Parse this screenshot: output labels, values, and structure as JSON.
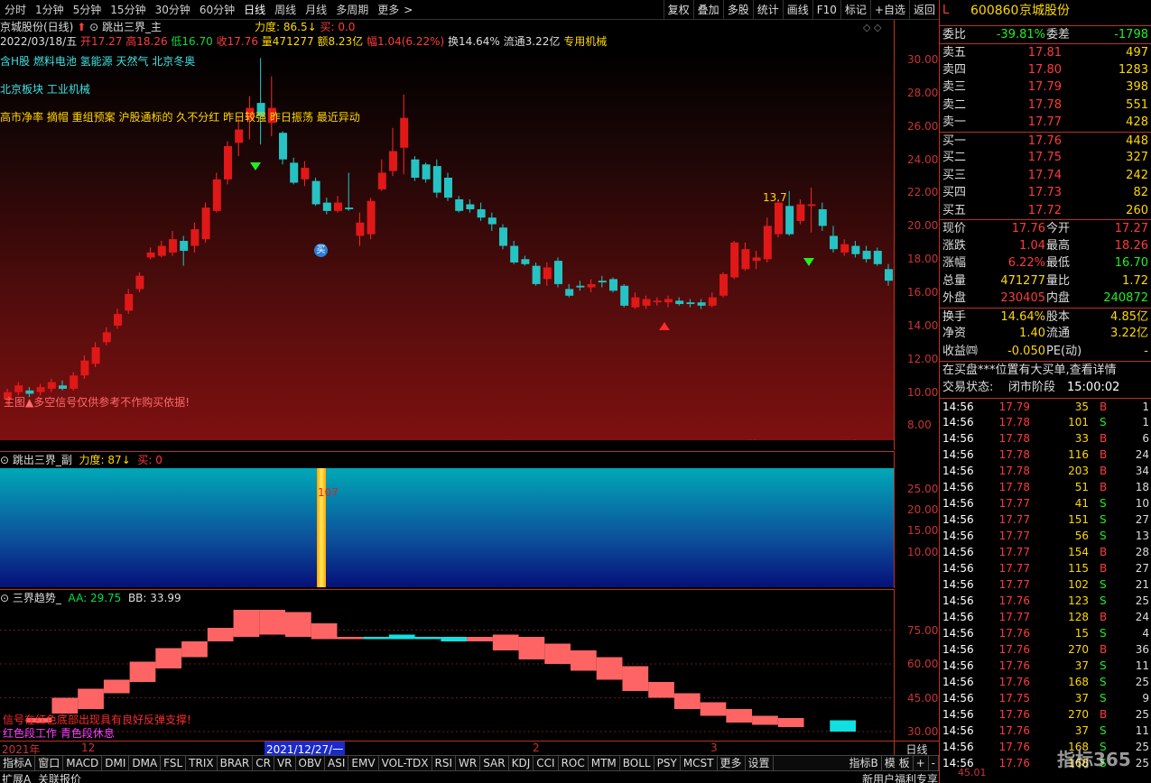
{
  "toolbar": {
    "periods": [
      "分时",
      "1分钟",
      "5分钟",
      "15分钟",
      "30分钟",
      "60分钟",
      "日线",
      "周线",
      "月线",
      "多周期",
      "更多"
    ],
    "active": "日线",
    "right_buttons": [
      "复权",
      "叠加",
      "多股",
      "统计",
      "画线",
      "F10",
      "标记",
      "+自选",
      "返回"
    ]
  },
  "main": {
    "stock": "京城股份(日线)",
    "formula": "跳出三界_主",
    "force_label": "力度: 86.5",
    "force_arrow": "↓",
    "buy_label": "买: 0.0",
    "date": "2022/03/18/五",
    "open": "开17.27",
    "high": "高18.26",
    "low": "低16.70",
    "close": "收17.76",
    "volume": "量471277",
    "amount": "额8.23亿",
    "change": "幅1.04(6.22%)",
    "turnover": "换14.64%",
    "float": "流通3.22亿",
    "industry": "专用机械",
    "concepts1": "含H股 燃料电池 氢能源 天然气 北京冬奥",
    "concepts2": "北京板块 工业机械",
    "concepts3": "高市净率 摘帽 重组预案 沪股通标的 久不分红 昨日较强 昨日振荡 最近异动",
    "notice": "主图▲多空信号仅供参考不作购买依据!",
    "peak_label": "13.7",
    "buy_marker": "买",
    "events": [
      "跌",
      "榜",
      "涨财"
    ]
  },
  "axis_main": [
    "30.00",
    "28.00",
    "26.00",
    "24.00",
    "22.00",
    "20.00",
    "18.00",
    "16.00",
    "14.00",
    "12.00",
    "10.00",
    "8.00"
  ],
  "sub1": {
    "title": "跳出三界_副",
    "force_label": "力度: 87",
    "force_arrow": "↓",
    "buy_label": "买: 0",
    "bar_label": "107",
    "axis": [
      "25.00",
      "20.00",
      "15.00",
      "10.00"
    ]
  },
  "sub2": {
    "title": "三界趋势_",
    "aa": "AA: 29.75",
    "bb": "BB: 33.99",
    "axis": [
      "75.00",
      "60.00",
      "45.00",
      "30.00"
    ],
    "note1": "信号在红色底部出现具有良好反弹支撑!",
    "note2": "红色段工作  青色段休息"
  },
  "dateaxis": {
    "labels": [
      "2021年",
      "12",
      "2021/12/27/一",
      "2",
      "3"
    ],
    "period": "日线"
  },
  "indicators": [
    "指标A",
    "窗口",
    "MACD",
    "DMI",
    "DMA",
    "FSL",
    "TRIX",
    "BRAR",
    "CR",
    "VR",
    "OBV",
    "ASI",
    "EMV",
    "VOL-TDX",
    "RSI",
    "WR",
    "SAR",
    "KDJ",
    "CCI",
    "ROC",
    "MTM",
    "BOLL",
    "PSY",
    "MCST",
    "更多",
    "设置"
  ],
  "indicator_right": [
    "指标B",
    "模 板",
    "+",
    "-"
  ],
  "bottom": {
    "left": [
      "扩展A",
      "关联报价"
    ],
    "right": "新用户福利专享",
    "price": "45.01"
  },
  "quote": {
    "flag": "L",
    "code": "600860",
    "name": "京城股份",
    "weibi_label": "委比",
    "weibi": "-39.81%",
    "weicha_label": "委差",
    "weicha": "-1798",
    "asks": [
      {
        "label": "卖五",
        "price": "17.81",
        "vol": "497"
      },
      {
        "label": "卖四",
        "price": "17.80",
        "vol": "1283"
      },
      {
        "label": "卖三",
        "price": "17.79",
        "vol": "398"
      },
      {
        "label": "卖二",
        "price": "17.78",
        "vol": "551"
      },
      {
        "label": "卖一",
        "price": "17.77",
        "vol": "428"
      }
    ],
    "bids": [
      {
        "label": "买一",
        "price": "17.76",
        "vol": "448"
      },
      {
        "label": "买二",
        "price": "17.75",
        "vol": "327"
      },
      {
        "label": "买三",
        "price": "17.74",
        "vol": "242"
      },
      {
        "label": "买四",
        "price": "17.73",
        "vol": "82"
      },
      {
        "label": "买五",
        "price": "17.72",
        "vol": "260"
      }
    ],
    "stats": [
      [
        "现价",
        "17.76",
        "今开",
        "17.27"
      ],
      [
        "涨跌",
        "1.04",
        "最高",
        "18.26"
      ],
      [
        "涨幅",
        "6.22%",
        "最低",
        "16.70"
      ],
      [
        "总量",
        "471277",
        "量比",
        "1.72"
      ],
      [
        "外盘",
        "230405",
        "内盘",
        "240872"
      ],
      [
        "换手",
        "14.64%",
        "股本",
        "4.85亿"
      ],
      [
        "净资",
        "1.40",
        "流通",
        "3.22亿"
      ],
      [
        "收益㈣",
        "-0.050",
        "PE(动)",
        "-"
      ]
    ],
    "message": "在买盘***位置有大买单,查看详情",
    "status_label": "交易状态:",
    "status": "闭市阶段",
    "status_time": "15:00:02"
  },
  "ticks": [
    [
      "14:56",
      "17.79",
      "35",
      "B",
      "1"
    ],
    [
      "14:56",
      "17.78",
      "101",
      "S",
      "1"
    ],
    [
      "14:56",
      "17.78",
      "33",
      "B",
      "6"
    ],
    [
      "14:56",
      "17.78",
      "116",
      "B",
      "24"
    ],
    [
      "14:56",
      "17.78",
      "203",
      "B",
      "34"
    ],
    [
      "14:56",
      "17.78",
      "51",
      "B",
      "18"
    ],
    [
      "14:56",
      "17.77",
      "41",
      "S",
      "10"
    ],
    [
      "14:56",
      "17.77",
      "151",
      "S",
      "27"
    ],
    [
      "14:56",
      "17.77",
      "56",
      "S",
      "13"
    ],
    [
      "14:56",
      "17.77",
      "154",
      "B",
      "28"
    ],
    [
      "14:56",
      "17.77",
      "115",
      "B",
      "27"
    ],
    [
      "14:56",
      "17.77",
      "102",
      "S",
      "21"
    ],
    [
      "14:56",
      "17.76",
      "123",
      "S",
      "25"
    ],
    [
      "14:56",
      "17.77",
      "128",
      "B",
      "24"
    ],
    [
      "14:56",
      "17.76",
      "15",
      "S",
      "4"
    ],
    [
      "14:56",
      "17.76",
      "270",
      "B",
      "36"
    ],
    [
      "14:56",
      "17.76",
      "37",
      "S",
      "11"
    ],
    [
      "14:56",
      "17.76",
      "168",
      "S",
      "25"
    ],
    [
      "14:56",
      "17.75",
      "37",
      "S",
      "9"
    ],
    [
      "14:56",
      "17.76",
      "270",
      "B",
      "25"
    ],
    [
      "14:56",
      "17.76",
      "37",
      "S",
      "11"
    ],
    [
      "14:56",
      "17.76",
      "168",
      "S",
      "25"
    ],
    [
      "14:56",
      "17.76",
      "168",
      "S",
      "25"
    ]
  ],
  "watermark": "指标365",
  "candles": [
    [
      8.4,
      8.8,
      8.0,
      9.0
    ],
    [
      8.8,
      9.2,
      8.6,
      9.4
    ],
    [
      8.9,
      8.7,
      8.5,
      9.1
    ],
    [
      8.8,
      9.1,
      8.6,
      9.3
    ],
    [
      9.0,
      9.4,
      8.8,
      9.6
    ],
    [
      9.2,
      9.0,
      8.9,
      9.5
    ],
    [
      9.0,
      9.8,
      8.9,
      10.0
    ],
    [
      9.8,
      10.7,
      9.6,
      11.0
    ],
    [
      10.5,
      11.5,
      10.3,
      11.8
    ],
    [
      11.8,
      12.4,
      11.6,
      12.7
    ],
    [
      12.8,
      13.5,
      12.6,
      13.8
    ],
    [
      13.7,
      14.7,
      13.5,
      15.0
    ],
    [
      15.0,
      15.8,
      14.8,
      16.0
    ],
    [
      16.9,
      17.2,
      16.8,
      17.5
    ],
    [
      17.0,
      17.6,
      16.9,
      17.9
    ],
    [
      17.2,
      18.0,
      17.0,
      18.5
    ],
    [
      17.9,
      17.3,
      16.4,
      18.2
    ],
    [
      17.6,
      18.6,
      17.2,
      19.0
    ],
    [
      18.0,
      19.9,
      17.8,
      20.2
    ],
    [
      19.7,
      21.6,
      19.6,
      22.0
    ],
    [
      21.6,
      23.6,
      21.3,
      23.9
    ],
    [
      23.8,
      24.6,
      23.0,
      25.4
    ],
    [
      25.2,
      25.9,
      24.0,
      26.6
    ],
    [
      26.2,
      25.4,
      23.7,
      28.9
    ],
    [
      25.0,
      25.9,
      24.2,
      27.8
    ],
    [
      24.4,
      22.8,
      22.5,
      24.5
    ],
    [
      22.6,
      21.4,
      21.3,
      22.9
    ],
    [
      21.6,
      22.3,
      21.2,
      22.7
    ],
    [
      21.5,
      20.1,
      20.0,
      21.7
    ],
    [
      20.2,
      19.7,
      19.5,
      20.5
    ],
    [
      19.7,
      20.2,
      19.6,
      20.6
    ],
    [
      19.9,
      19.8,
      19.7,
      22.0
    ],
    [
      18.2,
      19.0,
      17.6,
      19.6
    ],
    [
      18.3,
      20.3,
      18.0,
      20.5
    ],
    [
      21.0,
      22.0,
      20.9,
      22.8
    ],
    [
      22.1,
      23.3,
      21.8,
      24.7
    ],
    [
      23.5,
      25.3,
      21.9,
      26.7
    ],
    [
      22.8,
      21.7,
      21.5,
      23.0
    ],
    [
      22.5,
      21.6,
      21.4,
      22.6
    ],
    [
      22.4,
      20.8,
      20.5,
      22.8
    ],
    [
      21.7,
      20.5,
      20.3,
      22.0
    ],
    [
      20.4,
      19.7,
      19.6,
      20.6
    ],
    [
      20.1,
      19.8,
      19.6,
      20.4
    ],
    [
      19.8,
      19.3,
      19.1,
      20.2
    ],
    [
      19.3,
      18.9,
      18.5,
      19.6
    ],
    [
      18.7,
      17.6,
      17.4,
      18.9
    ],
    [
      17.6,
      16.6,
      16.5,
      17.9
    ],
    [
      16.8,
      16.5,
      16.4,
      17.0
    ],
    [
      16.4,
      15.3,
      15.2,
      16.6
    ],
    [
      15.6,
      16.3,
      15.2,
      16.6
    ],
    [
      16.7,
      15.3,
      15.1,
      16.9
    ],
    [
      15.0,
      14.6,
      14.5,
      15.3
    ],
    [
      15.2,
      15.1,
      14.9,
      15.5
    ],
    [
      15.1,
      15.3,
      14.8,
      15.6
    ],
    [
      15.5,
      15.4,
      15.1,
      15.8
    ],
    [
      15.6,
      14.9,
      14.8,
      15.7
    ],
    [
      15.2,
      14.0,
      13.9,
      15.3
    ],
    [
      13.9,
      14.5,
      13.8,
      14.8
    ],
    [
      14.0,
      14.4,
      13.8,
      14.6
    ],
    [
      14.2,
      14.3,
      14.0,
      14.5
    ],
    [
      14.2,
      14.4,
      13.9,
      14.6
    ],
    [
      14.3,
      14.1,
      14.0,
      14.5
    ],
    [
      14.2,
      14.1,
      13.9,
      14.4
    ],
    [
      14.2,
      14.0,
      13.8,
      14.4
    ],
    [
      14.0,
      14.5,
      13.9,
      14.8
    ],
    [
      14.6,
      15.9,
      14.5,
      16.0
    ],
    [
      15.7,
      17.8,
      15.6,
      17.9
    ],
    [
      16.2,
      17.4,
      16.1,
      17.8
    ],
    [
      16.7,
      16.9,
      16.2,
      17.3
    ],
    [
      16.8,
      18.8,
      16.6,
      19.3
    ],
    [
      18.3,
      20.2,
      18.1,
      20.3
    ],
    [
      20.0,
      18.3,
      18.2,
      20.9
    ],
    [
      19.1,
      20.1,
      18.9,
      20.4
    ],
    [
      20.0,
      20.1,
      18.4,
      21.1
    ],
    [
      19.8,
      18.8,
      18.5,
      20.2
    ],
    [
      18.2,
      17.4,
      17.2,
      18.8
    ],
    [
      17.2,
      17.7,
      17.0,
      18.0
    ],
    [
      17.6,
      17.1,
      16.9,
      17.9
    ],
    [
      17.3,
      16.8,
      16.6,
      17.6
    ],
    [
      17.3,
      16.5,
      16.4,
      17.5
    ],
    [
      16.2,
      15.5,
      15.2,
      16.5
    ],
    [
      15.0,
      15.1,
      14.4,
      15.6
    ],
    [
      15.3,
      16.6,
      15.2,
      17.0
    ],
    [
      17.2,
      17.8,
      16.7,
      18.3
    ]
  ],
  "sub2_aa": [
    35.0,
    36.0,
    45.0,
    49.0,
    53.0,
    61.0,
    67.0,
    70.0,
    76.0,
    84.0,
    84.0,
    83.0,
    78.0,
    72.0,
    71.0,
    71.0,
    71.0,
    70.0,
    72.0,
    73.0,
    72.0,
    69.0,
    66.0,
    63.0,
    59.0,
    52.0,
    47.0,
    43.0,
    40.0,
    37.0,
    36.0,
    34.0,
    30.0,
    29.8
  ],
  "sub2_bb": [
    35.0,
    34.0,
    38.0,
    40.0,
    47.0,
    52.0,
    58.0,
    63.0,
    70.0,
    72.0,
    73.0,
    72.0,
    71.0,
    71.0,
    72.0,
    73.0,
    72.0,
    72.0,
    70.0,
    66.0,
    62.0,
    60.0,
    57.0,
    53.0,
    48.0,
    45.0,
    40.0,
    37.0,
    34.0,
    33.0,
    32.0,
    34.0,
    35.0,
    34.0
  ]
}
